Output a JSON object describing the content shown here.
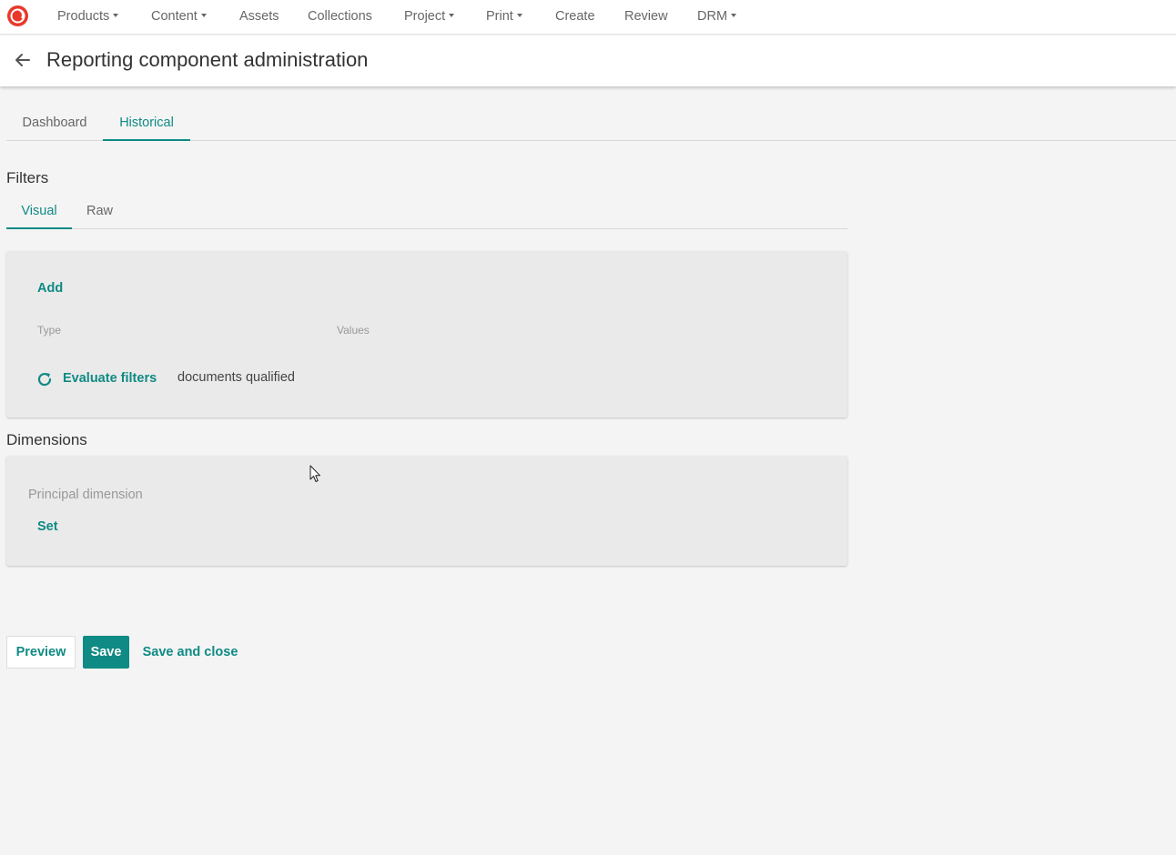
{
  "brand": {
    "accent": "#0f8a84",
    "logo_color": "#e8382a"
  },
  "topnav": {
    "items": [
      {
        "label": "Products",
        "dropdown": true
      },
      {
        "label": "Content",
        "dropdown": true
      },
      {
        "label": "Assets",
        "dropdown": false
      },
      {
        "label": "Collections",
        "dropdown": false
      },
      {
        "label": "Project",
        "dropdown": true
      },
      {
        "label": "Print",
        "dropdown": true
      },
      {
        "label": "Create",
        "dropdown": false
      },
      {
        "label": "Review",
        "dropdown": false
      },
      {
        "label": "DRM",
        "dropdown": true
      }
    ]
  },
  "header": {
    "title": "Reporting component administration"
  },
  "tabs": {
    "main": [
      {
        "label": "Dashboard",
        "active": false
      },
      {
        "label": "Historical",
        "active": true
      }
    ]
  },
  "filters": {
    "title": "Filters",
    "tabs": [
      {
        "label": "Visual",
        "active": true
      },
      {
        "label": "Raw",
        "active": false
      }
    ],
    "add_label": "Add",
    "columns": {
      "type": "Type",
      "values": "Values"
    },
    "evaluate_label": "Evaluate filters",
    "qualified_text": "documents qualified"
  },
  "dimensions": {
    "title": "Dimensions",
    "principal_label": "Principal dimension",
    "set_label": "Set"
  },
  "footer": {
    "preview_label": "Preview",
    "save_label": "Save",
    "save_close_label": "Save and close"
  }
}
